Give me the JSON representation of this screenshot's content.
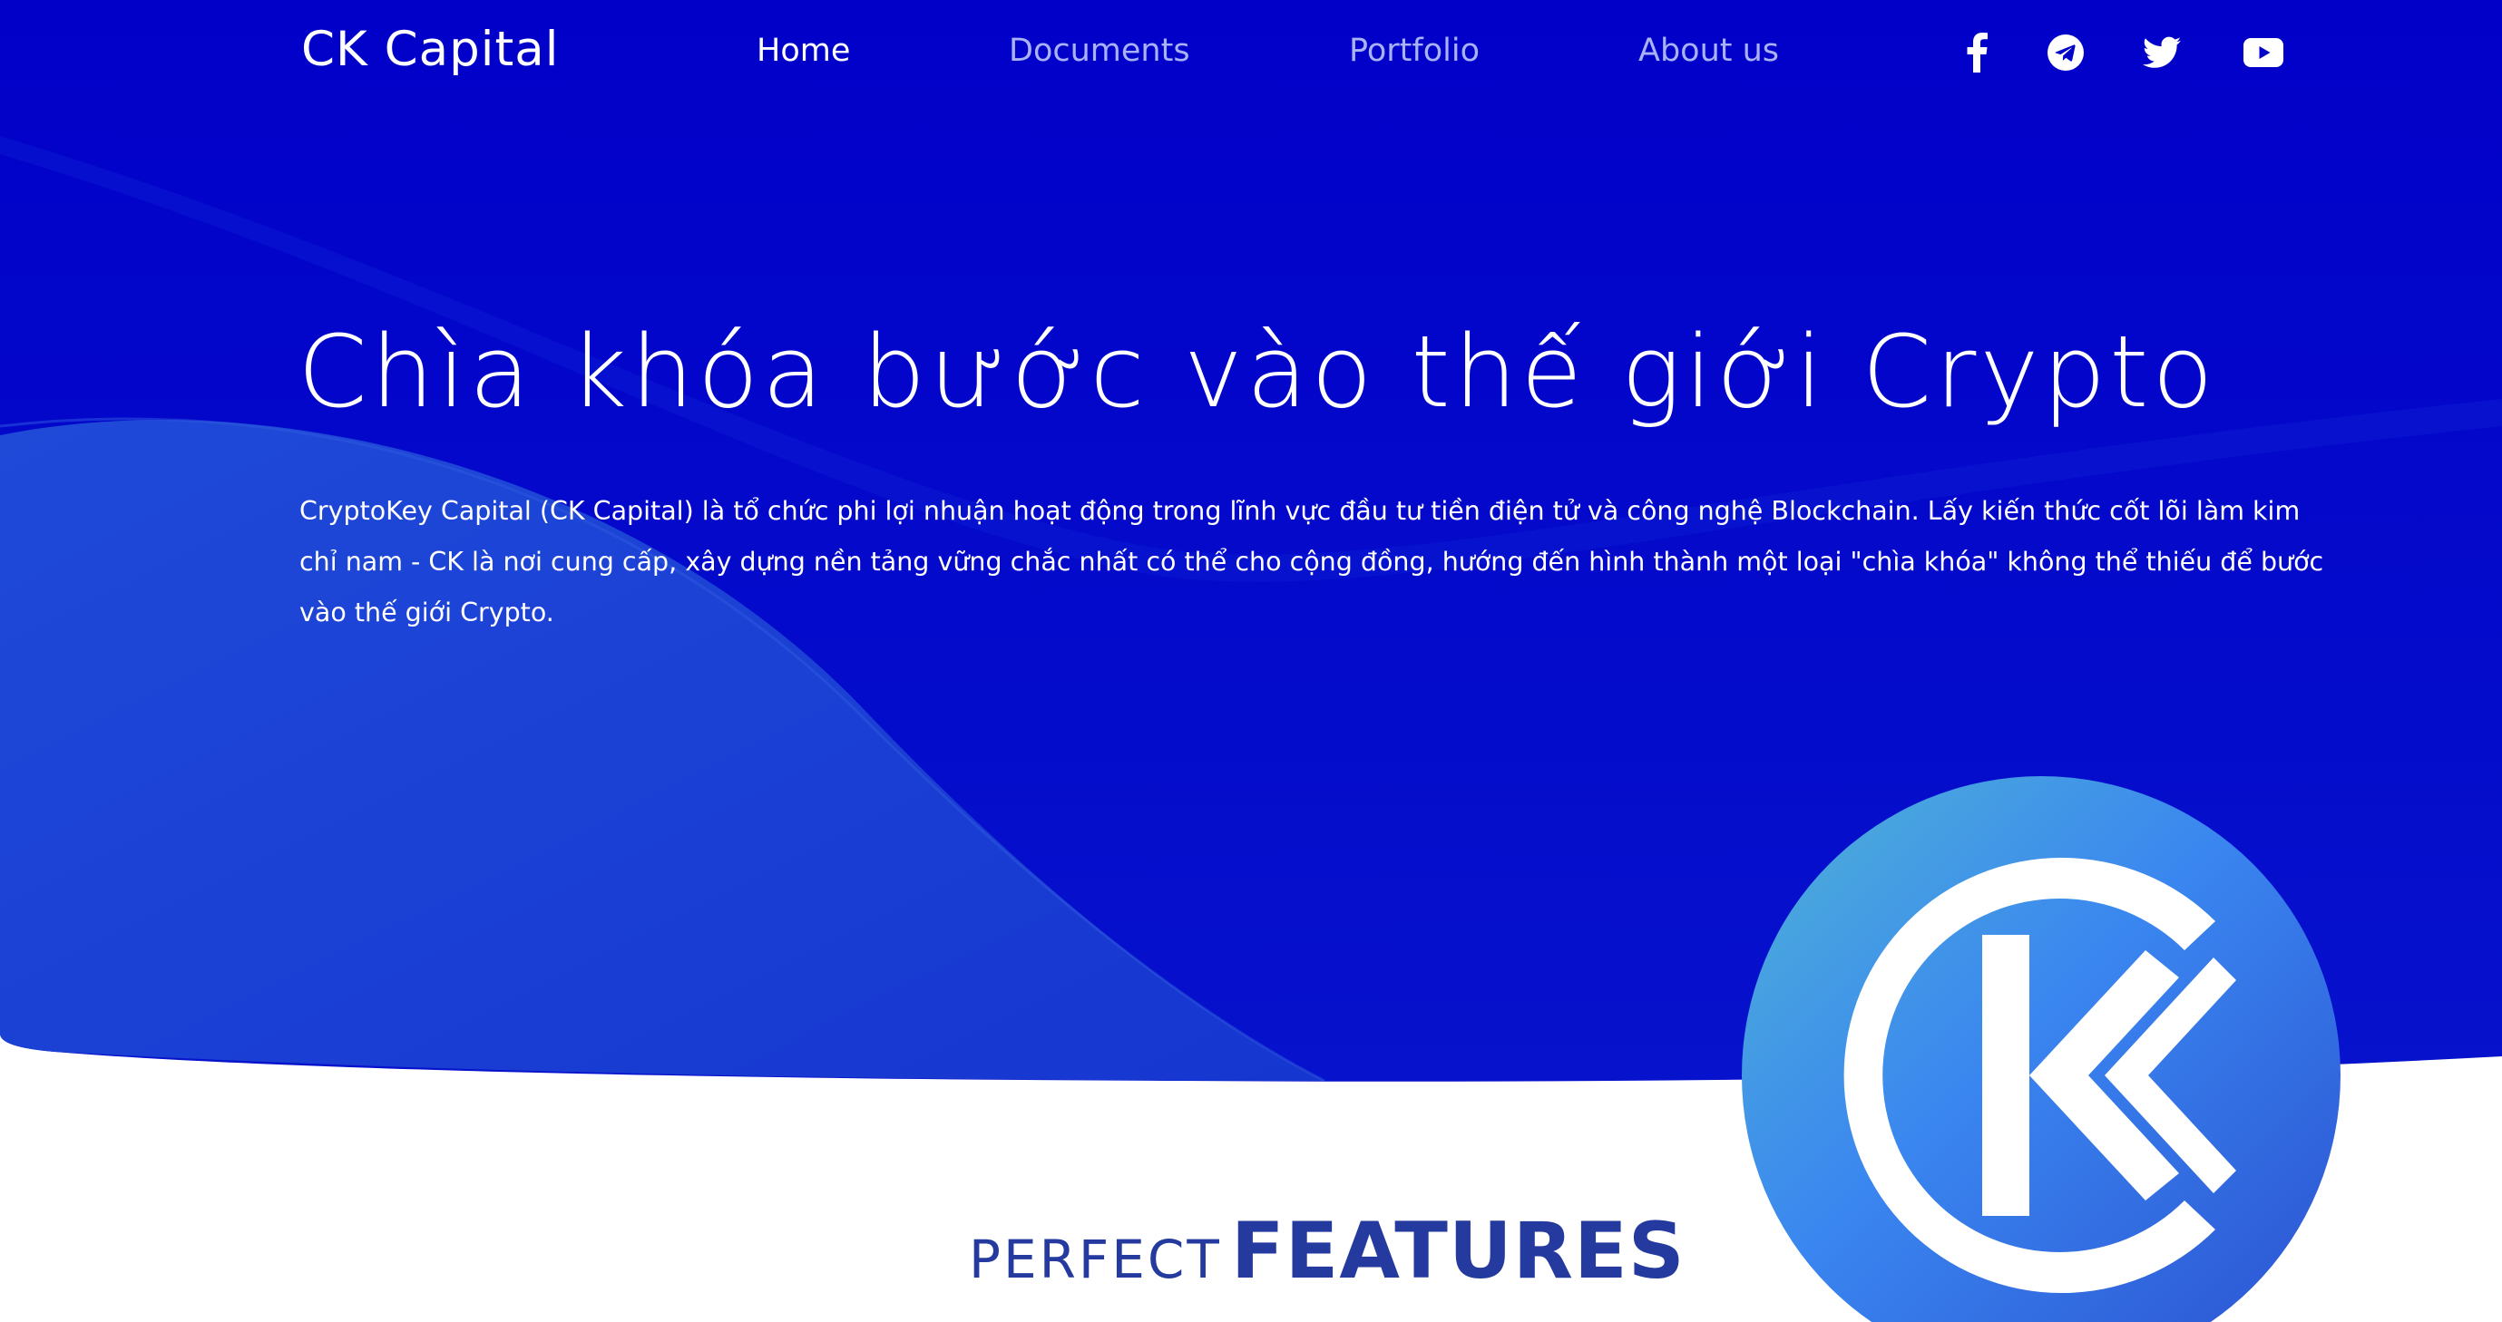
{
  "brand": {
    "name": "CK Capital"
  },
  "nav": {
    "items": [
      {
        "label": "Home"
      },
      {
        "label": "Documents"
      },
      {
        "label": "Portfolio"
      },
      {
        "label": "About us"
      }
    ]
  },
  "social": {
    "icons": [
      "facebook-icon",
      "telegram-icon",
      "twitter-icon",
      "youtube-icon"
    ]
  },
  "hero": {
    "title": "Chìa khóa bước vào thế giới Crypto",
    "description": "CryptoKey Capital (CK Capital) là tổ chức phi lợi nhuận hoạt động trong lĩnh vực đầu tư tiền điện tử và công nghệ Blockchain. Lấy kiến thức cốt lõi làm kim chỉ nam - CK là nơi cung cấp, xây dựng nền tảng vững chắc nhất có thể cho cộng đồng, hướng đến hình thành một loại \"chìa khóa\" không thể thiếu để bước vào thế giới Crypto."
  },
  "features": {
    "prefix": "PERFECT",
    "title": "FEATURES"
  },
  "colors": {
    "hero_bg": "#0203c8",
    "hero_wave": "#1d46d6",
    "nav_inactive": "#a9b2f4",
    "heading_accent": "#243a9e"
  }
}
